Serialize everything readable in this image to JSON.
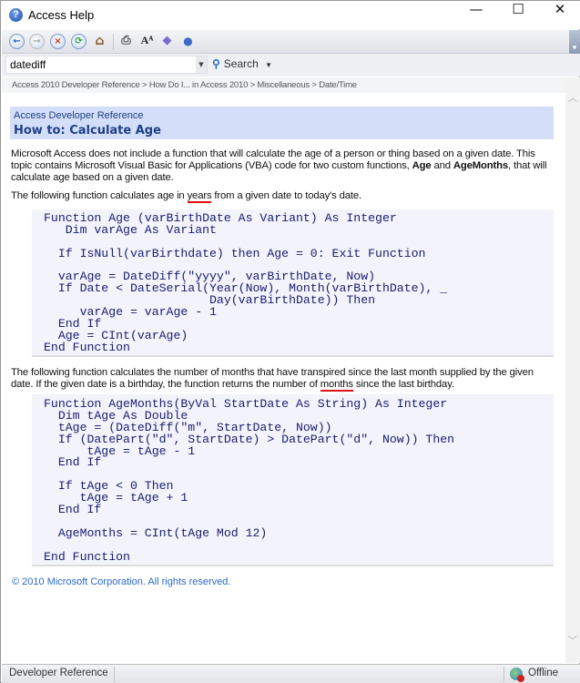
{
  "window": {
    "title": "Access Help",
    "minimize": "—",
    "maximize": "☐",
    "close": "✕"
  },
  "toolbar": {
    "buttons": [
      "back-icon",
      "forward-icon",
      "stop-icon",
      "refresh-icon",
      "home-icon",
      "print-icon",
      "text-size-icon",
      "table-of-contents-icon",
      "keep-on-top-icon"
    ]
  },
  "search": {
    "value": "datediff",
    "button_label": "Search"
  },
  "breadcrumb": "Access 2010 Developer Reference > How Do I... in Access 2010 > Miscellaneous > Date/Time",
  "article": {
    "subtitle": "Access Developer Reference",
    "title": "How to: Calculate Age",
    "intro_a": "Microsoft Access does not include a function that will calculate the age of a person or thing based on a given date. This topic contains Microsoft Visual Basic for Applications (VBA) code for two custom functions, ",
    "intro_age": "Age",
    "intro_and": " and ",
    "intro_agemonths": "AgeMonths",
    "intro_b": ", that will calculate age based on a given date.",
    "p2_a": "The following function calculates age in ",
    "p2_years": "years",
    "p2_b": " from a given date to today's date.",
    "code1": [
      "Function Age (varBirthDate As Variant) As Integer",
      "   Dim varAge As Variant",
      "",
      "  If IsNull(varBirthdate) then Age = 0: Exit Function",
      "",
      "  varAge = DateDiff(\"yyyy\", varBirthDate, Now)",
      "  If Date < DateSerial(Year(Now), Month(varBirthDate), _",
      "                       Day(varBirthDate)) Then",
      "     varAge = varAge - 1",
      "  End If",
      "  Age = CInt(varAge)",
      "End Function"
    ],
    "p3_a": "The following function calculates the number of months that have transpired since the last month supplied by the given date. If the given date is a birthday, the function returns the number of ",
    "p3_months": "months",
    "p3_b": " since the last birthday.",
    "code2": [
      "Function AgeMonths(ByVal StartDate As String) As Integer",
      "  Dim tAge As Double",
      "  tAge = (DateDiff(\"m\", StartDate, Now))",
      "  If (DatePart(\"d\", StartDate) > DatePart(\"d\", Now)) Then",
      "      tAge = tAge - 1",
      "  End If",
      "",
      "  If tAge < 0 Then",
      "     tAge = tAge + 1",
      "  End If",
      "",
      "  AgeMonths = CInt(tAge Mod 12)",
      "",
      "End Function"
    ],
    "copyright": "© 2010 Microsoft Corporation. All rights reserved."
  },
  "statusbar": {
    "left": "Developer Reference",
    "right": "Offline"
  }
}
